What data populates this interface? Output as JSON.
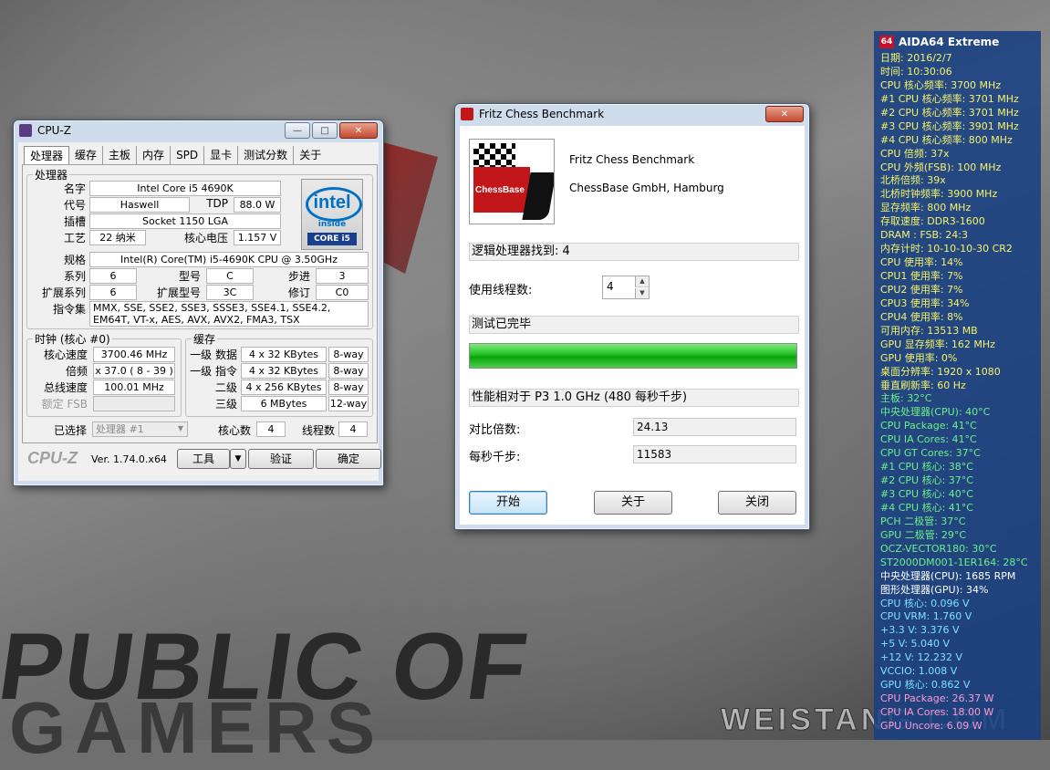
{
  "background": {
    "text_line1": "PUBLIC OF",
    "text_line2": "GAMERS",
    "watermark": "WEISTANG.COM"
  },
  "cpuz": {
    "title": "CPU-Z",
    "tabs": [
      "处理器",
      "缓存",
      "主板",
      "内存",
      "SPD",
      "显卡",
      "测试分数",
      "关于"
    ],
    "processor_group": "处理器",
    "labels": {
      "name": "名字",
      "codename": "代号",
      "tdp": "TDP",
      "package": "插槽",
      "tech": "工艺",
      "voltage": "核心电压",
      "spec": "规格",
      "family": "系列",
      "model": "型号",
      "stepping": "步进",
      "ext_family": "扩展系列",
      "ext_model": "扩展型号",
      "revision": "修订",
      "instructions": "指令集"
    },
    "values": {
      "name": "Intel Core i5 4690K",
      "codename": "Haswell",
      "tdp": "88.0 W",
      "package": "Socket 1150 LGA",
      "tech": "22 纳米",
      "voltage": "1.157 V",
      "spec": "Intel(R) Core(TM) i5-4690K CPU @ 3.50GHz",
      "family": "6",
      "model": "C",
      "stepping": "3",
      "ext_family": "6",
      "ext_model": "3C",
      "revision": "C0",
      "instructions": "MMX, SSE, SSE2, SSE3, SSSE3, SSE4.1, SSE4.2, EM64T, VT-x, AES, AVX, AVX2, FMA3, TSX"
    },
    "intel_logo": {
      "word": "intel",
      "inside": "inside",
      "core": "CORE i5"
    },
    "clocks_group": "时钟 (核心 #0)",
    "clock_labels": {
      "core_speed": "核心速度",
      "multiplier": "倍频",
      "bus_speed": "总线速度",
      "rated_fsb": "额定 FSB"
    },
    "clock_values": {
      "core_speed": "3700.46 MHz",
      "multiplier": "x 37.0 ( 8 - 39 )",
      "bus_speed": "100.01 MHz",
      "rated_fsb": ""
    },
    "cache_group": "缓存",
    "cache_rows": [
      {
        "label": "一级 数据",
        "size": "4 x 32 KBytes",
        "way": "8-way"
      },
      {
        "label": "一级 指令",
        "size": "4 x 32 KBytes",
        "way": "8-way"
      },
      {
        "label": "二级",
        "size": "4 x 256 KBytes",
        "way": "8-way"
      },
      {
        "label": "三级",
        "size": "6 MBytes",
        "way": "12-way"
      }
    ],
    "selection": {
      "label": "已选择",
      "value": "处理器 #1",
      "cores_label": "核心数",
      "cores": "4",
      "threads_label": "线程数",
      "threads": "4"
    },
    "footer": {
      "logo": "CPU-Z",
      "version": "Ver. 1.74.0.x64",
      "tools": "工具",
      "validate": "验证",
      "ok": "确定"
    }
  },
  "fritz": {
    "title": "Fritz Chess Benchmark",
    "logo_text": "ChessBase",
    "app_name": "Fritz Chess Benchmark",
    "company": "ChessBase GmbH, Hamburg",
    "logical_processors": "逻辑处理器找到: 4",
    "threads_label": "使用线程数:",
    "threads_value": "4",
    "status": "测试已完毕",
    "progress": 1.0,
    "relative_perf": "性能相对于 P3 1.0 GHz (480 每秒千步)",
    "ratio_label": "对比倍数:",
    "ratio_value": "24.13",
    "knps_label": "每秒千步:",
    "knps_value": "11583",
    "buttons": {
      "start": "开始",
      "about": "关于",
      "close": "关闭"
    }
  },
  "aida": {
    "logo": "64",
    "title": "AIDA64 Extreme",
    "rows": [
      {
        "text": "日期: 2016/2/7",
        "color": "#f4f46a"
      },
      {
        "text": "时间: 10:30:06",
        "color": "#f4f46a"
      },
      {
        "text": "CPU 核心频率: 3700 MHz",
        "color": "#f4f46a"
      },
      {
        "text": "#1 CPU 核心频率: 3701 MHz",
        "color": "#f4f46a"
      },
      {
        "text": "#2 CPU 核心频率: 3701 MHz",
        "color": "#f4f46a"
      },
      {
        "text": "#3 CPU 核心频率: 3901 MHz",
        "color": "#f4f46a"
      },
      {
        "text": "#4 CPU 核心频率: 800 MHz",
        "color": "#f4f46a"
      },
      {
        "text": "CPU 倍频: 37x",
        "color": "#f4f46a"
      },
      {
        "text": "CPU 外频(FSB): 100 MHz",
        "color": "#f4f46a"
      },
      {
        "text": "北桥倍频: 39x",
        "color": "#f4f46a"
      },
      {
        "text": "北桥时钟频率: 3900 MHz",
        "color": "#f4f46a"
      },
      {
        "text": "显存频率: 800 MHz",
        "color": "#f4f46a"
      },
      {
        "text": "存取速度: DDR3-1600",
        "color": "#f4f46a"
      },
      {
        "text": "DRAM : FSB: 24:3",
        "color": "#f4f46a"
      },
      {
        "text": "内存计时: 10-10-10-30 CR2",
        "color": "#f4f46a"
      },
      {
        "text": "CPU 使用率: 14%",
        "color": "#f4f46a"
      },
      {
        "text": "CPU1 使用率: 7%",
        "color": "#f4f46a"
      },
      {
        "text": "CPU2 使用率: 7%",
        "color": "#f4f46a"
      },
      {
        "text": "CPU3 使用率: 34%",
        "color": "#f4f46a"
      },
      {
        "text": "CPU4 使用率: 8%",
        "color": "#f4f46a"
      },
      {
        "text": "可用内存: 13513 MB",
        "color": "#f4f46a"
      },
      {
        "text": "GPU 显存频率: 162 MHz",
        "color": "#f4f46a"
      },
      {
        "text": "GPU 使用率: 0%",
        "color": "#f4f46a"
      },
      {
        "text": "桌面分辨率: 1920 x 1080",
        "color": "#f4f46a"
      },
      {
        "text": "垂直刷新率: 60 Hz",
        "color": "#f4f46a"
      },
      {
        "text": "主板: 32°C",
        "color": "#6ef08a"
      },
      {
        "text": "中央处理器(CPU): 40°C",
        "color": "#6ef08a"
      },
      {
        "text": "CPU Package: 41°C",
        "color": "#6ef08a"
      },
      {
        "text": "CPU IA Cores: 41°C",
        "color": "#6ef08a"
      },
      {
        "text": "CPU GT Cores: 37°C",
        "color": "#6ef08a"
      },
      {
        "text": "#1 CPU 核心: 38°C",
        "color": "#6ef08a"
      },
      {
        "text": "#2 CPU 核心: 37°C",
        "color": "#6ef08a"
      },
      {
        "text": "#3 CPU 核心: 40°C",
        "color": "#6ef08a"
      },
      {
        "text": "#4 CPU 核心: 41°C",
        "color": "#6ef08a"
      },
      {
        "text": "PCH 二极管: 37°C",
        "color": "#6ef08a"
      },
      {
        "text": "GPU 二极管: 29°C",
        "color": "#6ef08a"
      },
      {
        "text": "OCZ-VECTOR180: 30°C",
        "color": "#6ef08a"
      },
      {
        "text": "ST2000DM001-1ER164: 28°C",
        "color": "#6ef08a"
      },
      {
        "text": "中央处理器(CPU): 1685 RPM",
        "color": "#ffffff"
      },
      {
        "text": "图形处理器(GPU): 34%",
        "color": "#ffffff"
      },
      {
        "text": "CPU 核心: 0.096 V",
        "color": "#7fe0ff"
      },
      {
        "text": "CPU VRM: 1.760 V",
        "color": "#7fe0ff"
      },
      {
        "text": "+3.3 V: 3.376 V",
        "color": "#7fe0ff"
      },
      {
        "text": "+5 V: 5.040 V",
        "color": "#7fe0ff"
      },
      {
        "text": "+12 V: 12.232 V",
        "color": "#7fe0ff"
      },
      {
        "text": "VCCIO: 1.008 V",
        "color": "#7fe0ff"
      },
      {
        "text": "GPU 核心: 0.862 V",
        "color": "#7fe0ff"
      },
      {
        "text": "CPU Package: 26.37 W",
        "color": "#ff9ad0"
      },
      {
        "text": "CPU IA Cores: 18.00 W",
        "color": "#ff9ad0"
      },
      {
        "text": "GPU Uncore: 6.09 W",
        "color": "#ff9ad0"
      }
    ]
  }
}
